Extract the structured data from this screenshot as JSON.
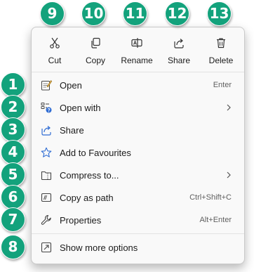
{
  "toolbar": [
    {
      "label": "Cut",
      "icon": "scissors-icon"
    },
    {
      "label": "Copy",
      "icon": "copy-icon"
    },
    {
      "label": "Rename",
      "icon": "rename-icon"
    },
    {
      "label": "Share",
      "icon": "share-icon"
    },
    {
      "label": "Delete",
      "icon": "trash-icon"
    }
  ],
  "items": [
    {
      "label": "Open",
      "shortcut": "Enter",
      "icon": "open-icon"
    },
    {
      "label": "Open with",
      "submenu": true,
      "icon": "open-with-icon"
    },
    {
      "label": "Share",
      "icon": "share-icon"
    },
    {
      "label": "Add to Favourites",
      "icon": "star-icon"
    },
    {
      "label": "Compress to...",
      "submenu": true,
      "icon": "zip-folder-icon"
    },
    {
      "label": "Copy as path",
      "shortcut": "Ctrl+Shift+C",
      "icon": "copy-path-icon"
    },
    {
      "label": "Properties",
      "shortcut": "Alt+Enter",
      "icon": "wrench-icon"
    },
    {
      "label": "Show more options",
      "icon": "more-options-icon"
    }
  ],
  "badges": {
    "toolbar": [
      "9",
      "10",
      "11",
      "12",
      "13"
    ],
    "items": [
      "1",
      "2",
      "3",
      "4",
      "5",
      "6",
      "7",
      "8"
    ]
  },
  "colors": {
    "badge": "#13a27c",
    "accent": "#2f6cd3"
  }
}
